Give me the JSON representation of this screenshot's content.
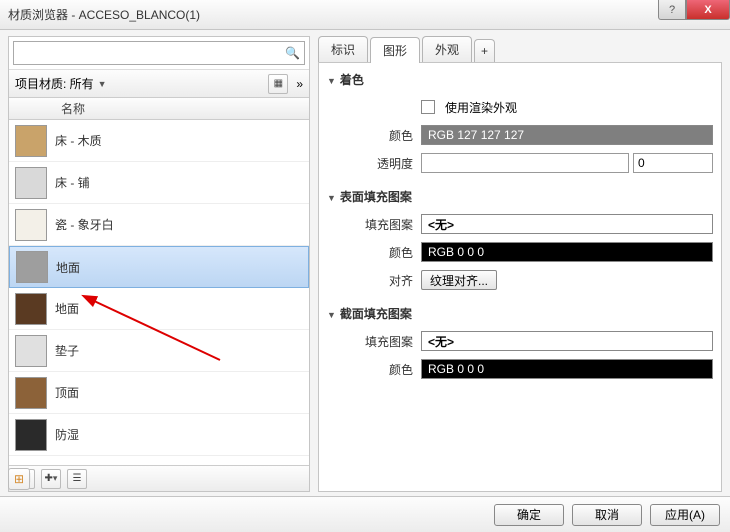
{
  "window": {
    "title": "材质浏览器 - ACCESO_BLANCO(1)",
    "help": "?",
    "close": "X"
  },
  "left": {
    "search_placeholder": "",
    "filter_label": "项目材质: 所有",
    "expand": "»",
    "col_name": "名称",
    "items": [
      {
        "label": "床 - 木质",
        "thumb": "#c9a36a"
      },
      {
        "label": "床 - 铺",
        "thumb": "#d9d9d9"
      },
      {
        "label": "瓷 - 象牙白",
        "thumb": "#f3f0e8"
      },
      {
        "label": "地面",
        "thumb": "#9e9e9e",
        "selected": true
      },
      {
        "label": "地面",
        "thumb": "#5a3a22"
      },
      {
        "label": "垫子",
        "thumb": "#e0e0e0"
      },
      {
        "label": "顶面",
        "thumb": "#8c6239"
      },
      {
        "label": "防湿",
        "thumb": "#2a2a2a"
      }
    ]
  },
  "tabs": {
    "t1": "标识",
    "t2": "图形",
    "t3": "外观",
    "plus": "+"
  },
  "panel": {
    "shade_title": "着色",
    "use_render": "使用渲染外观",
    "color_label": "颜色",
    "shade_color": "RGB 127 127 127",
    "trans_label": "透明度",
    "trans_value": "0",
    "surface_title": "表面填充图案",
    "fill_label": "填充图案",
    "none": "<无>",
    "surface_color": "RGB 0 0 0",
    "align_label": "对齐",
    "align_btn": "纹理对齐...",
    "cut_title": "截面填充图案",
    "cut_color": "RGB 0 0 0"
  },
  "footer": {
    "ok": "确定",
    "cancel": "取消",
    "apply": "应用(A)"
  }
}
